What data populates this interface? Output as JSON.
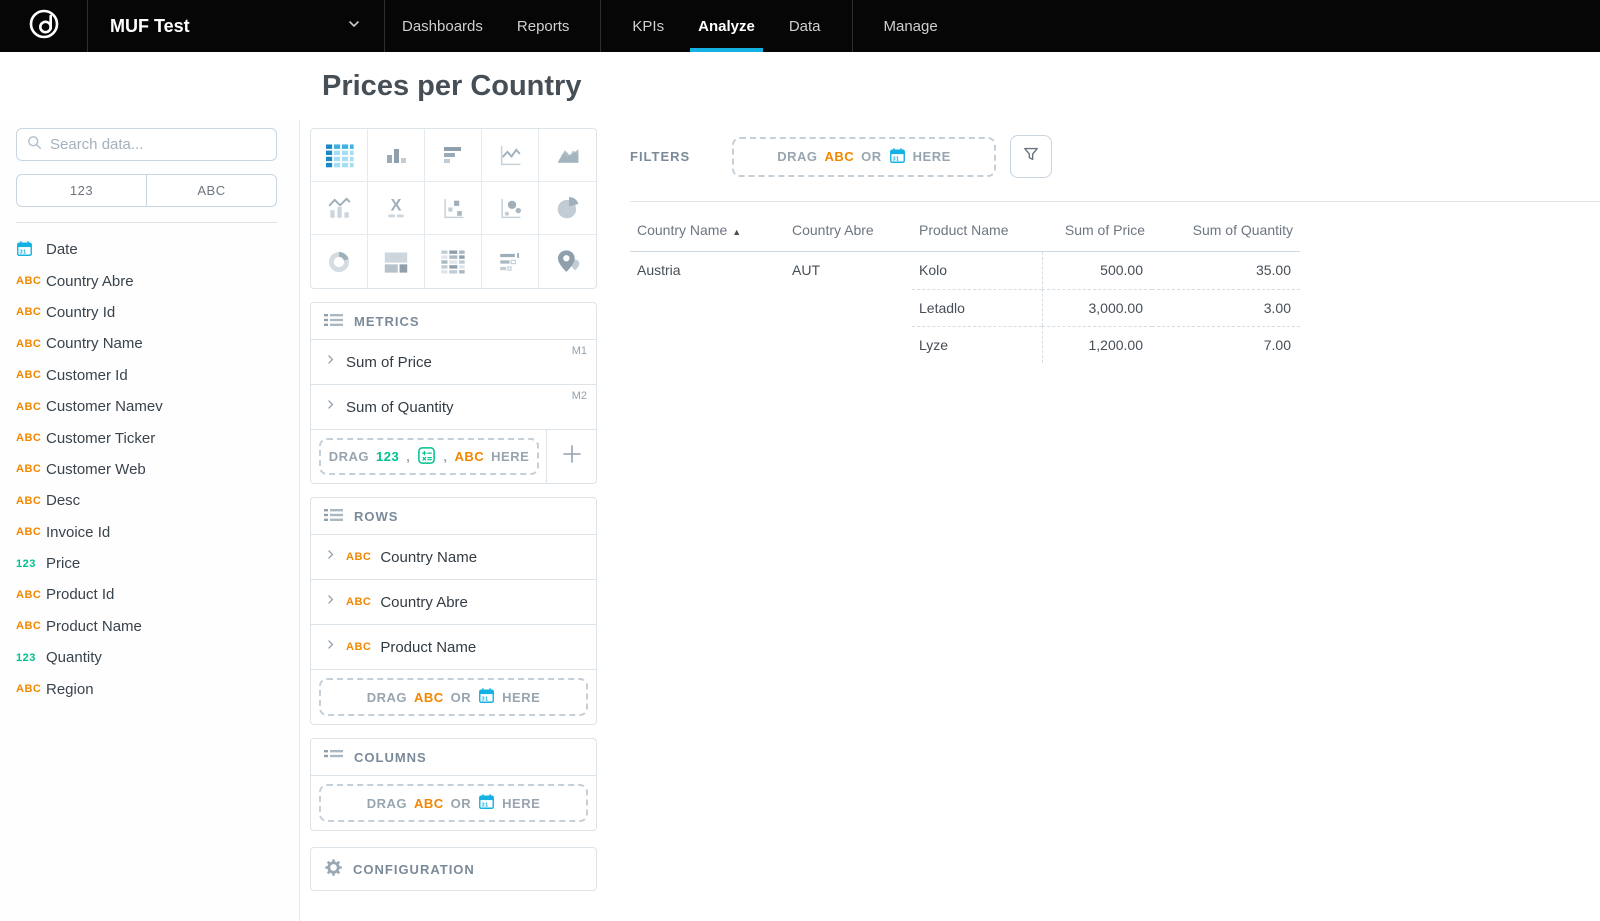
{
  "colors": {
    "accent": "#14b2e2",
    "attribute_orange": "#f38700",
    "measure_green": "#00c18e",
    "nav_bg": "#060606",
    "title_text": "#464e56",
    "muted_text": "#6d7680"
  },
  "navbar": {
    "project_name": "MUF Test",
    "links": [
      {
        "label": "Dashboards",
        "active": false
      },
      {
        "label": "Reports",
        "active": false
      },
      {
        "label": "KPIs",
        "active": false
      },
      {
        "label": "Analyze",
        "active": true
      },
      {
        "label": "Data",
        "active": false
      },
      {
        "label": "Manage",
        "active": false
      }
    ]
  },
  "page": {
    "title": "Prices per Country"
  },
  "sidebar": {
    "search_placeholder": "Search data...",
    "toggles": [
      "123",
      "ABC"
    ],
    "fields": [
      {
        "type": "date",
        "icon": "",
        "label": "Date"
      },
      {
        "type": "attribute",
        "icon": "ABC",
        "label": "Country Abre"
      },
      {
        "type": "attribute",
        "icon": "ABC",
        "label": "Country Id"
      },
      {
        "type": "attribute",
        "icon": "ABC",
        "label": "Country Name"
      },
      {
        "type": "attribute",
        "icon": "ABC",
        "label": "Customer Id"
      },
      {
        "type": "attribute",
        "icon": "ABC",
        "label": "Customer Namev"
      },
      {
        "type": "attribute",
        "icon": "ABC",
        "label": "Customer Ticker"
      },
      {
        "type": "attribute",
        "icon": "ABC",
        "label": "Customer Web"
      },
      {
        "type": "attribute",
        "icon": "ABC",
        "label": "Desc"
      },
      {
        "type": "attribute",
        "icon": "ABC",
        "label": "Invoice Id"
      },
      {
        "type": "fact",
        "icon": "123",
        "label": "Price"
      },
      {
        "type": "attribute",
        "icon": "ABC",
        "label": "Product Id"
      },
      {
        "type": "attribute",
        "icon": "ABC",
        "label": "Product Name"
      },
      {
        "type": "fact",
        "icon": "123",
        "label": "Quantity"
      },
      {
        "type": "attribute",
        "icon": "ABC",
        "label": "Region"
      }
    ]
  },
  "viz_picker": {
    "selected": "table",
    "types": [
      "table",
      "column-chart",
      "bar-chart",
      "line-chart",
      "area-chart",
      "combo-chart",
      "headline",
      "scatter-plot",
      "bubble-chart",
      "pie-chart",
      "donut-chart",
      "treemap",
      "heatmap",
      "bullet-chart",
      "geo-pushpin"
    ]
  },
  "buckets": {
    "metrics": {
      "title": "METRICS",
      "items": [
        {
          "label": "Sum of Price",
          "tag": "M1"
        },
        {
          "label": "Sum of Quantity",
          "tag": "M2"
        }
      ],
      "dropzone": {
        "drag": "DRAG",
        "num": "123",
        "comma": ",",
        "abc": "ABC",
        "here": "HERE"
      }
    },
    "rows": {
      "title": "ROWS",
      "items": [
        {
          "prefix": "ABC",
          "label": "Country Name"
        },
        {
          "prefix": "ABC",
          "label": "Country Abre"
        },
        {
          "prefix": "ABC",
          "label": "Product Name"
        }
      ],
      "dropzone": {
        "drag": "DRAG",
        "abc": "ABC",
        "or": "OR",
        "here": "HERE"
      }
    },
    "columns": {
      "title": "COLUMNS",
      "dropzone": {
        "drag": "DRAG",
        "abc": "ABC",
        "or": "OR",
        "here": "HERE"
      }
    },
    "configuration": {
      "title": "CONFIGURATION"
    }
  },
  "filters": {
    "label": "FILTERS",
    "dropzone": {
      "drag": "DRAG",
      "abc": "ABC",
      "or": "OR",
      "here": "HERE"
    }
  },
  "table": {
    "columns": [
      "Country Name",
      "Country Abre",
      "Product Name",
      "Sum of Price",
      "Sum of Quantity"
    ],
    "sort_column": "Country Name",
    "sort_indicator": "▲",
    "rows": [
      [
        "Austria",
        "AUT",
        "Kolo",
        "500.00",
        "35.00"
      ],
      [
        "",
        "",
        "Letadlo",
        "3,000.00",
        "3.00"
      ],
      [
        "",
        "",
        "Lyze",
        "1,200.00",
        "7.00"
      ]
    ]
  }
}
